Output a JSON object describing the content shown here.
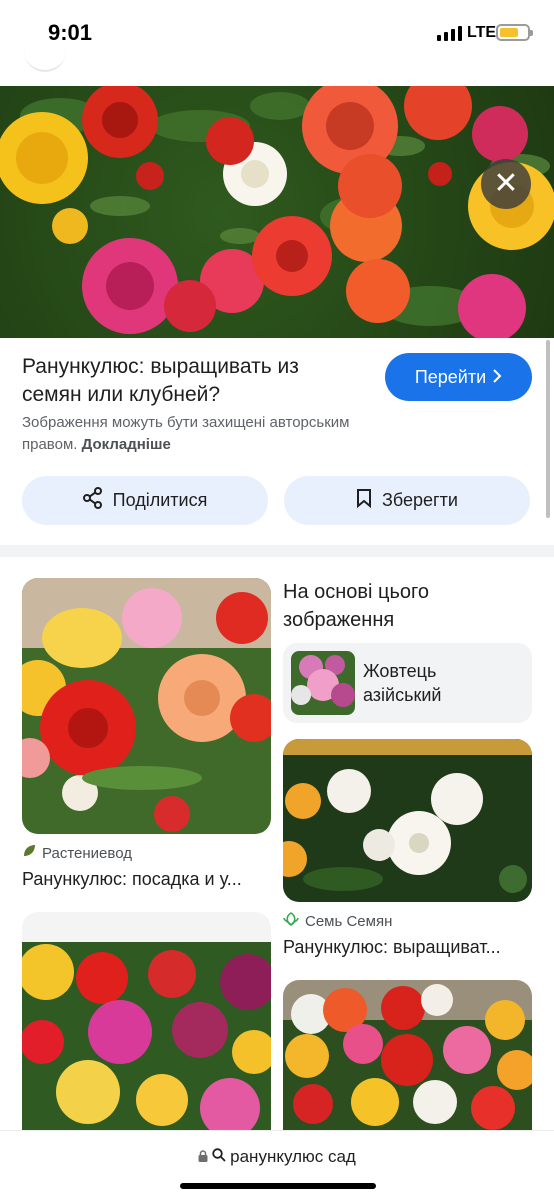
{
  "status_bar": {
    "time": "9:01",
    "network": "LTE"
  },
  "preview": {
    "title": "Ранункулюс: выращивать из семян или клубней?",
    "go_button": "Перейти",
    "copyright_text": "Зображення можуть бути захищені авторським правом.",
    "more_link": "Докладніше",
    "share_button": "Поділитися",
    "save_button": "Зберегти"
  },
  "results": {
    "left": [
      {
        "source": "Растениевод",
        "title": "Ранункулюс: посадка и у..."
      }
    ],
    "right": [
      {
        "source": "Семь Семян",
        "title": "Ранункулюс: выращиват..."
      }
    ]
  },
  "related": {
    "heading": "На основі цього зображення",
    "chip_label": "Жовтець азійський"
  },
  "address_bar": {
    "query": "ранункулюс сад"
  },
  "colors": {
    "accent": "#1a73e8",
    "chip_bg": "#e8f0fe",
    "foliage": "#2f5a1e"
  },
  "icons": [
    "close-icon",
    "lens-icon",
    "share-icon",
    "bookmark-icon",
    "leaf-icon",
    "seeds-icon",
    "lock-icon",
    "search-icon",
    "chevron-right-icon"
  ]
}
